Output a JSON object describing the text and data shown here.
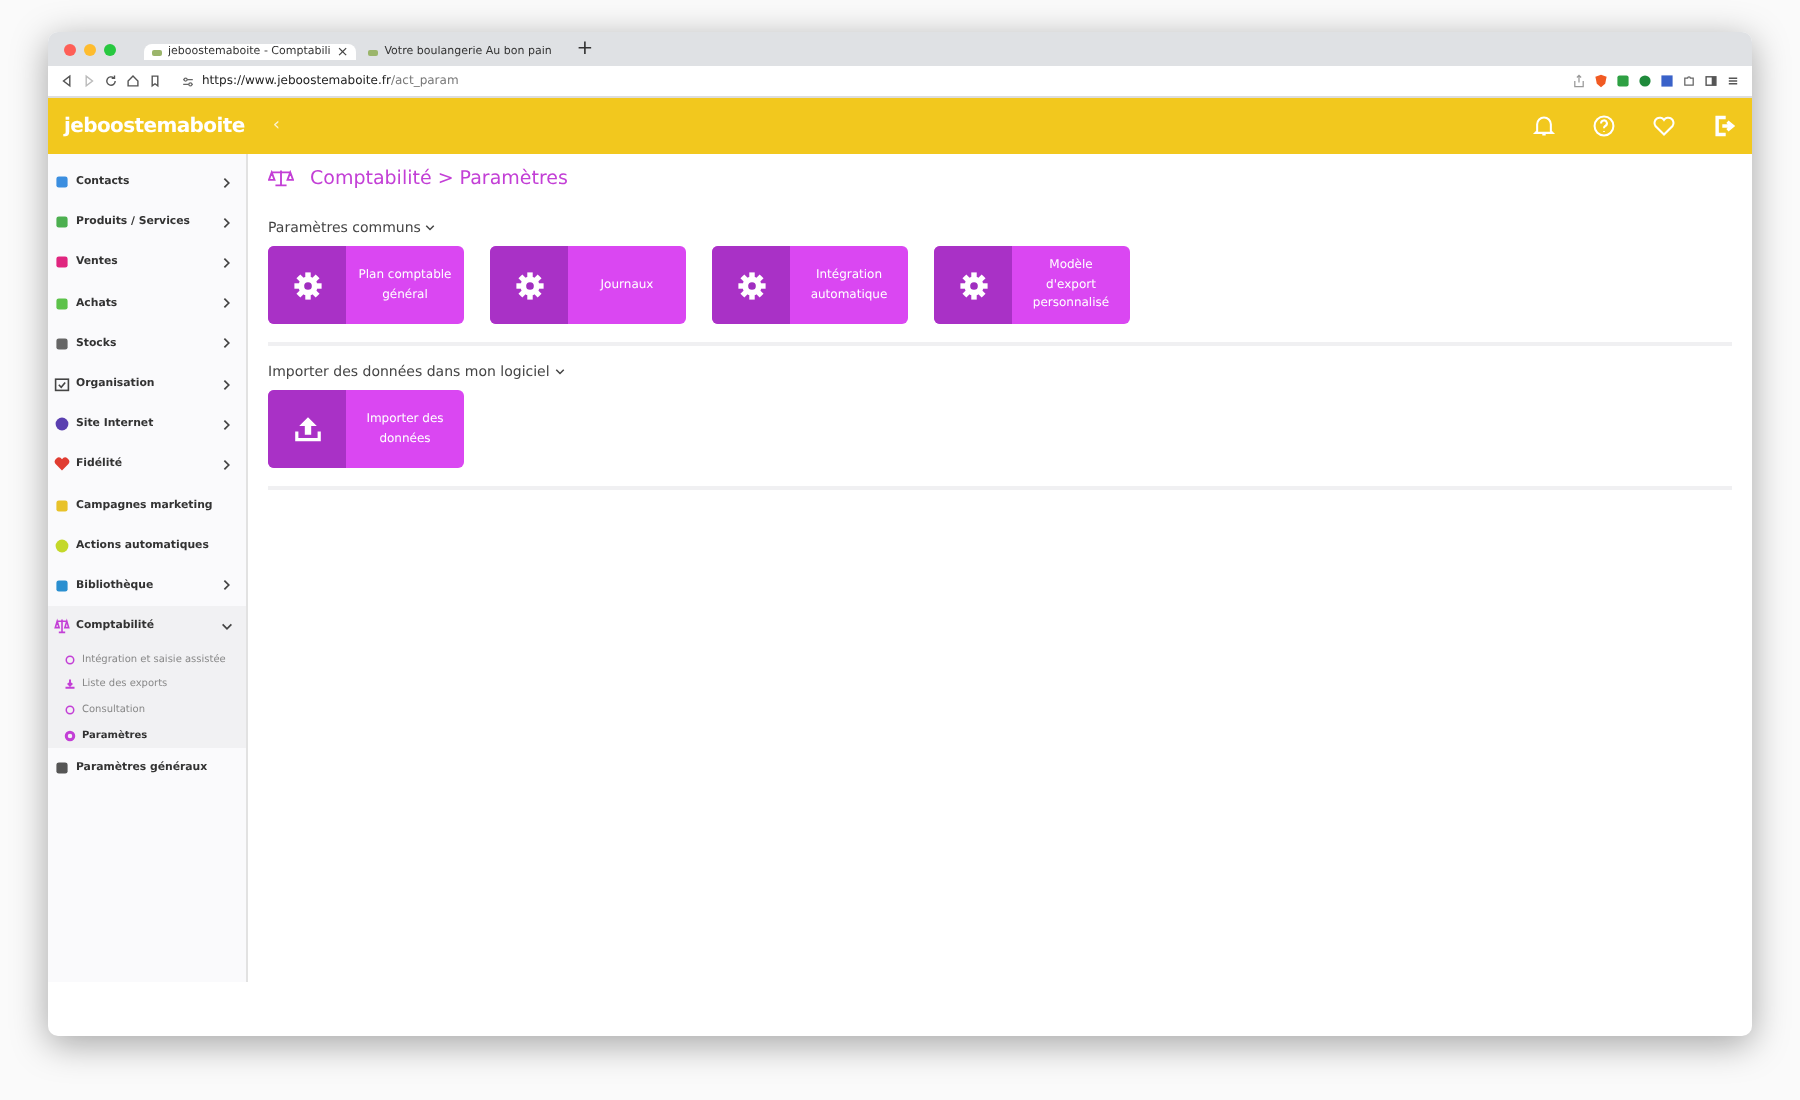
{
  "browser": {
    "tabs": [
      {
        "title": "jeboostemaboite - Comptabili",
        "selected": true,
        "close": "×"
      },
      {
        "title": "Votre boulangerie Au bon pain",
        "selected": false
      }
    ],
    "new_tab": "+",
    "url": {
      "host": "https://www.jeboostemaboite.fr",
      "path": "/act_param"
    }
  },
  "header": {
    "logo": "jeboostemaboite",
    "collapse": "‹"
  },
  "sidebar": {
    "items": [
      {
        "label": "Contacts",
        "expanded": false
      },
      {
        "label": "Produits / Services",
        "expanded": false
      },
      {
        "label": "Ventes",
        "expanded": false
      },
      {
        "label": "Achats",
        "expanded": false
      },
      {
        "label": "Stocks",
        "expanded": false
      },
      {
        "label": "Organisation",
        "expanded": false
      },
      {
        "label": "Site Internet",
        "expanded": false
      },
      {
        "label": "Fidélité",
        "expanded": false
      },
      {
        "label": "Campagnes marketing"
      },
      {
        "label": "Actions automatiques"
      },
      {
        "label": "Bibliothèque",
        "expanded": false
      },
      {
        "label": "Comptabilité",
        "expanded": true,
        "children": [
          {
            "label": "Intégration et saisie assistée",
            "selected": false
          },
          {
            "label": "Liste des exports",
            "selected": false
          },
          {
            "label": "Consultation",
            "selected": false
          },
          {
            "label": "Paramètres",
            "selected": true
          }
        ]
      },
      {
        "label": "Paramètres généraux"
      }
    ]
  },
  "breadcrumb": {
    "section": "Comptabilité",
    "separator": ">",
    "page": "Paramètres"
  },
  "sections": [
    {
      "title": "Paramètres communs",
      "tiles": [
        {
          "label": "Plan comptable général"
        },
        {
          "label": "Journaux"
        },
        {
          "label": "Intégration automatique"
        },
        {
          "label": "Modèle d'export personnalisé"
        }
      ]
    },
    {
      "title": "Importer des données dans mon logiciel",
      "tiles": [
        {
          "label": "Importer des données"
        }
      ]
    }
  ]
}
